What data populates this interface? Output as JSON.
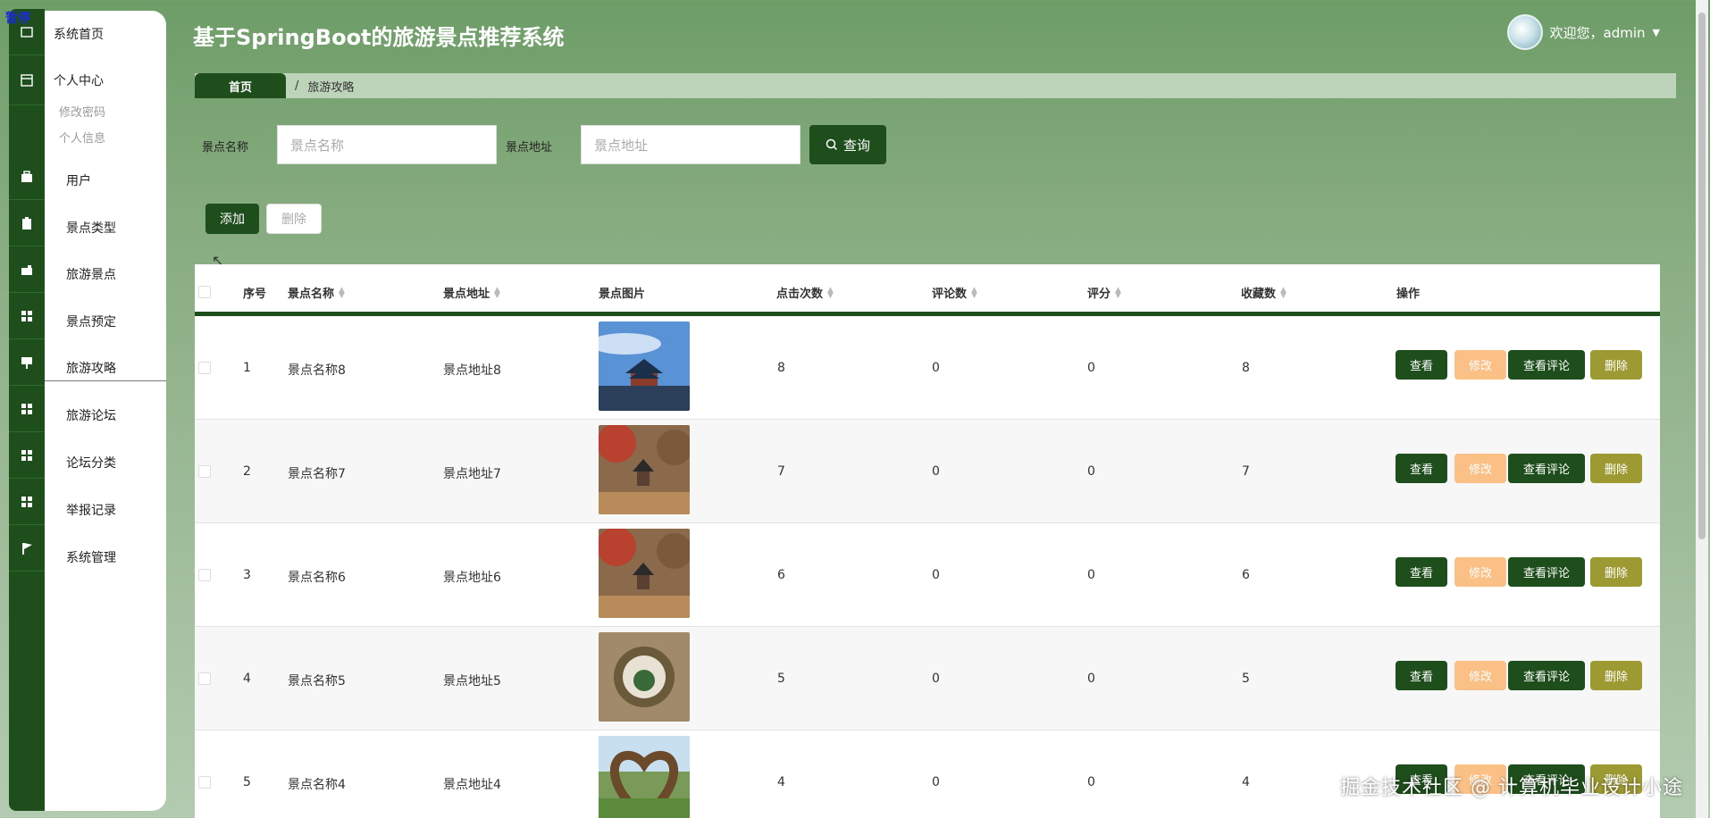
{
  "rail_tag": "暂停",
  "header": {
    "title": "基于SpringBoot的旅游景点推荐系统",
    "welcome": "欢迎您，admin"
  },
  "menu": {
    "home": "系统首页",
    "personal": "个人中心",
    "change_password": "修改密码",
    "personal_info": "个人信息",
    "items": [
      "用户",
      "景点类型",
      "旅游景点",
      "景点预定",
      "旅游攻略",
      "旅游论坛",
      "论坛分类",
      "举报记录",
      "系统管理"
    ],
    "active_index": 4
  },
  "breadcrumb": {
    "home": "首页",
    "separator": "/",
    "current": "旅游攻略"
  },
  "search": {
    "name_label": "景点名称",
    "name_placeholder": "景点名称",
    "addr_label": "景点地址",
    "addr_placeholder": "景点地址",
    "query_button": "查询"
  },
  "toolbar": {
    "add": "添加",
    "delete": "删除"
  },
  "table": {
    "headers": [
      "序号",
      "景点名称",
      "景点地址",
      "景点图片",
      "点击次数",
      "评论数",
      "评分",
      "收藏数",
      "操作"
    ],
    "rows": [
      {
        "idx": "1",
        "name": "景点名称8",
        "addr": "景点地址8",
        "clicks": "8",
        "comments": "0",
        "score": "0",
        "favs": "8"
      },
      {
        "idx": "2",
        "name": "景点名称7",
        "addr": "景点地址7",
        "clicks": "7",
        "comments": "0",
        "score": "0",
        "favs": "7"
      },
      {
        "idx": "3",
        "name": "景点名称6",
        "addr": "景点地址6",
        "clicks": "6",
        "comments": "0",
        "score": "0",
        "favs": "6"
      },
      {
        "idx": "4",
        "name": "景点名称5",
        "addr": "景点地址5",
        "clicks": "5",
        "comments": "0",
        "score": "0",
        "favs": "5"
      },
      {
        "idx": "5",
        "name": "景点名称4",
        "addr": "景点地址4",
        "clicks": "4",
        "comments": "0",
        "score": "0",
        "favs": "4"
      }
    ],
    "actions": {
      "view": "查看",
      "edit": "修改",
      "comments": "查看评论",
      "delete": "删除"
    }
  },
  "watermark": "掘金技术社区 @ 计算机毕业设计小途",
  "colors": {
    "primary": "#1e4e1b",
    "edit": "#fbc086",
    "delete": "#9d9a33"
  }
}
